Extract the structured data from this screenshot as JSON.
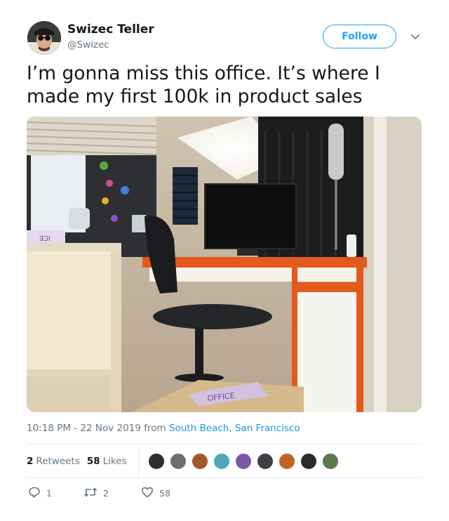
{
  "author": {
    "name": "Swizec Teller",
    "handle": "@Swizec",
    "follow_label": "Follow"
  },
  "tweet": {
    "text": "I’m gonna miss this office. It’s where I made my first 100k in product sales"
  },
  "photo": {
    "visible_labels": [
      "ICE",
      "OFFICE"
    ]
  },
  "meta": {
    "time": "10:18 PM - 22 Nov 2019",
    "from_word": "from",
    "place": "South Beach, San Francisco"
  },
  "stats": {
    "retweets_count": "2",
    "retweets_label": "Retweets",
    "likes_count": "58",
    "likes_label": "Likes"
  },
  "actions": {
    "reply_count": "1",
    "retweet_count": "2",
    "like_count": "58"
  },
  "colors": {
    "accent": "#1da1f2",
    "link": "#1b95e0",
    "muted": "#657786",
    "text": "#14171a"
  },
  "icons": [
    "chevron-down-icon",
    "reply-icon",
    "retweet-icon",
    "heart-icon"
  ]
}
